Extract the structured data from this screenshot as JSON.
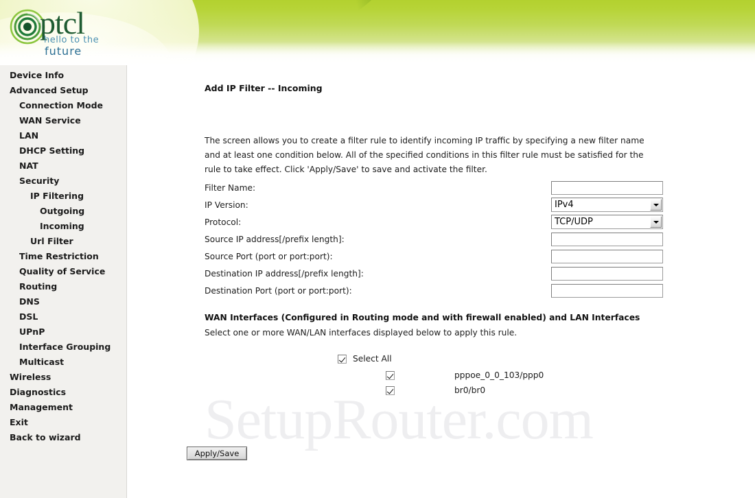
{
  "brand": {
    "logo_word": "ptcl",
    "tagline_line1": "hello to the",
    "tagline_line2": "future",
    "logo_mark_icon": "ptcl-spiral-eye-icon",
    "green": "#b3d12f",
    "dark_green": "#1f5c32",
    "teal": "#2c6f94"
  },
  "sidebar": {
    "items": [
      {
        "label": "Device Info",
        "level": 0
      },
      {
        "label": "Advanced Setup",
        "level": 0
      },
      {
        "label": "Connection Mode",
        "level": 1
      },
      {
        "label": "WAN Service",
        "level": 1
      },
      {
        "label": "LAN",
        "level": 1
      },
      {
        "label": "DHCP Setting",
        "level": 1
      },
      {
        "label": "NAT",
        "level": 1
      },
      {
        "label": "Security",
        "level": 1
      },
      {
        "label": "IP Filtering",
        "level": 2
      },
      {
        "label": "Outgoing",
        "level": 3
      },
      {
        "label": "Incoming",
        "level": 3
      },
      {
        "label": "Url Filter",
        "level": 2
      },
      {
        "label": "Time Restriction",
        "level": 1
      },
      {
        "label": "Quality of Service",
        "level": 1
      },
      {
        "label": "Routing",
        "level": 1
      },
      {
        "label": "DNS",
        "level": 1
      },
      {
        "label": "DSL",
        "level": 1
      },
      {
        "label": "UPnP",
        "level": 1
      },
      {
        "label": "Interface Grouping",
        "level": 1
      },
      {
        "label": "Multicast",
        "level": 1
      },
      {
        "label": "Wireless",
        "level": 0
      },
      {
        "label": "Diagnostics",
        "level": 0
      },
      {
        "label": "Management",
        "level": 0
      },
      {
        "label": "Exit",
        "level": 0
      },
      {
        "label": "Back to wizard",
        "level": 0
      }
    ]
  },
  "main": {
    "title": "Add IP Filter -- Incoming",
    "intro": "The screen allows you to create a filter rule to identify incoming IP traffic by specifying a new filter name and at least one condition below. All of the specified conditions in this filter rule must be satisfied for the rule to take effect. Click 'Apply/Save' to save and activate the filter.",
    "watermark": "SetupRouter.com",
    "form_rows": [
      {
        "label": "Filter Name:",
        "type": "text",
        "value": ""
      },
      {
        "label": "IP Version:",
        "type": "select",
        "value": "IPv4"
      },
      {
        "label": "Protocol:",
        "type": "select",
        "value": "TCP/UDP"
      },
      {
        "label": "Source IP address[/prefix length]:",
        "type": "text",
        "value": ""
      },
      {
        "label": "Source Port (port or port:port):",
        "type": "text",
        "value": ""
      },
      {
        "label": "Destination IP address[/prefix length]:",
        "type": "text",
        "value": ""
      },
      {
        "label": "Destination Port (port or port:port):",
        "type": "text",
        "value": ""
      }
    ],
    "interfaces_section": {
      "heading": "WAN Interfaces (Configured in Routing mode and with firewall enabled) and LAN Interfaces",
      "subtext": "Select one or more WAN/LAN interfaces displayed below to apply this rule.",
      "select_all_label": "Select All",
      "select_all_checked": true,
      "items": [
        {
          "name": "pppoe_0_0_103/ppp0",
          "checked": true
        },
        {
          "name": "br0/br0",
          "checked": true
        }
      ]
    },
    "apply_button": "Apply/Save"
  }
}
